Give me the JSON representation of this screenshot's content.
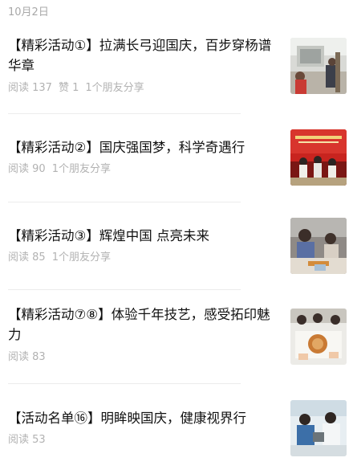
{
  "date_header": "10月2日",
  "articles": [
    {
      "title": "【精彩活动①】拉满长弓迎国庆，百步穿杨谱华章",
      "reads": "阅读 137",
      "likes": "赞 1",
      "shares": "1个朋友分享",
      "thumb_icon": "archery-photo-thumbnail"
    },
    {
      "title": "【精彩活动②】国庆强国梦，科学奇遇行",
      "reads": "阅读 90",
      "likes": "",
      "shares": "1个朋友分享",
      "thumb_icon": "stage-event-photo-thumbnail"
    },
    {
      "title": "【精彩活动③】辉煌中国 点亮未来",
      "reads": "阅读 85",
      "likes": "",
      "shares": "1个朋友分享",
      "thumb_icon": "craft-class-photo-thumbnail"
    },
    {
      "title": "【精彩活动⑦⑧】体验千年技艺，感受拓印魅力",
      "reads": "阅读 83",
      "likes": "",
      "shares": "",
      "thumb_icon": "rubbing-workshop-photo-thumbnail"
    },
    {
      "title": "【活动名单⑯】明眸映国庆，健康视界行",
      "reads": "阅读 53",
      "likes": "",
      "shares": "",
      "thumb_icon": "eye-exam-photo-thumbnail"
    }
  ],
  "colors": {
    "title": "#111111",
    "meta": "#b2b2b2",
    "date": "#a8a8a8",
    "divider": "#ececec"
  }
}
